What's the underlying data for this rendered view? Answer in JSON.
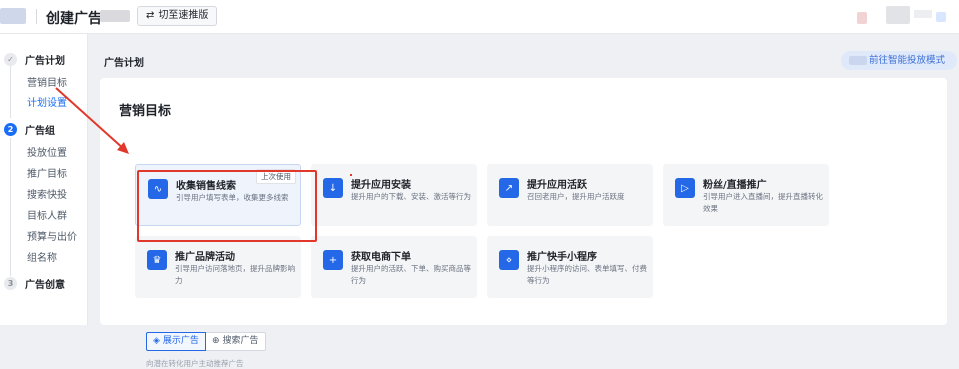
{
  "header": {
    "title": "创建广告",
    "switch_label": "切至速推版",
    "switch_icon": "swap-icon"
  },
  "sidebar": {
    "steps": [
      {
        "num": "✓",
        "label": "广告计划",
        "subs": [
          "营销目标",
          "计划设置"
        ]
      },
      {
        "num": "2",
        "label": "广告组",
        "subs": [
          "投放位置",
          "推广目标",
          "搜索快投",
          "目标人群",
          "预算与出价",
          "组名称"
        ]
      },
      {
        "num": "3",
        "label": "广告创意",
        "subs": []
      }
    ]
  },
  "main": {
    "section_title": "广告计划",
    "smart_button": "前往智能投放模式",
    "panel_title": "营销目标",
    "cards": [
      {
        "title": "收集销售线索",
        "desc": "引导用户填写表单，收集更多线索",
        "badge": "上次使用",
        "icon": "wave-icon"
      },
      {
        "title": "提升应用安装",
        "desc": "提升用户的下载、安装、激活等行为",
        "icon": "download-icon"
      },
      {
        "title": "提升应用活跃",
        "desc": "召回老用户，提升用户活跃度",
        "icon": "trend-icon"
      },
      {
        "title": "粉丝/直播推广",
        "desc": "引导用户进入直播间，提升直播转化效果",
        "icon": "video-icon"
      },
      {
        "title": "推广品牌活动",
        "desc": "引导用户访问落地页，提升品牌影响力",
        "icon": "crown-icon"
      },
      {
        "title": "获取电商下单",
        "desc": "提升用户的活跃、下单、购买商品等行为",
        "icon": "cart-icon"
      },
      {
        "title": "推广快手小程序",
        "desc": "提升小程序的访问、表单填写、付费等行为",
        "icon": "link-icon"
      }
    ],
    "tabs": [
      "展示广告",
      "搜索广告"
    ],
    "tab_hint": "向潜在转化用户主动推荐广告"
  },
  "colors": {
    "accent": "#2468e8",
    "annotation": "#e0382b"
  }
}
